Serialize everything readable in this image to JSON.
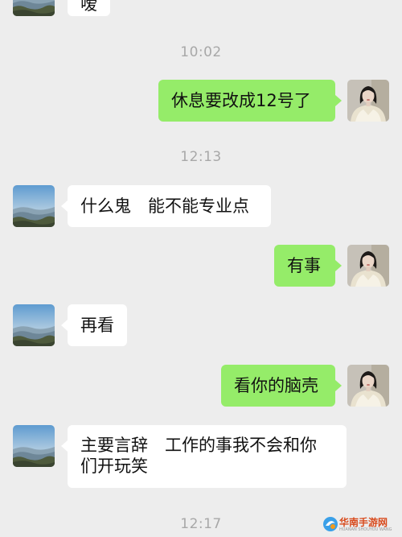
{
  "messages": {
    "m0": "嗳",
    "t1": "10:02",
    "m1": "休息要改成12号了",
    "t2": "12:13",
    "m2": "什么鬼　能不能专业点",
    "m3": "有事",
    "m4": "再看",
    "m5": "看你的脑壳",
    "m6_line1": "主要言辞　工作的事我不会和你",
    "m6_line2": "们开玩笑",
    "t3": "12:17"
  },
  "watermark": {
    "brand": "华南手游网",
    "sub": "HUANAN SHOUYOU WANG"
  },
  "colors": {
    "background": "#ededed",
    "outgoing_bubble": "#95ec69",
    "incoming_bubble": "#ffffff",
    "timestamp": "#a8a8a8"
  },
  "icons": {
    "left_avatar": "landscape-avatar-icon",
    "right_avatar": "portrait-avatar-icon",
    "watermark_logo": "huanan-logo-icon"
  }
}
